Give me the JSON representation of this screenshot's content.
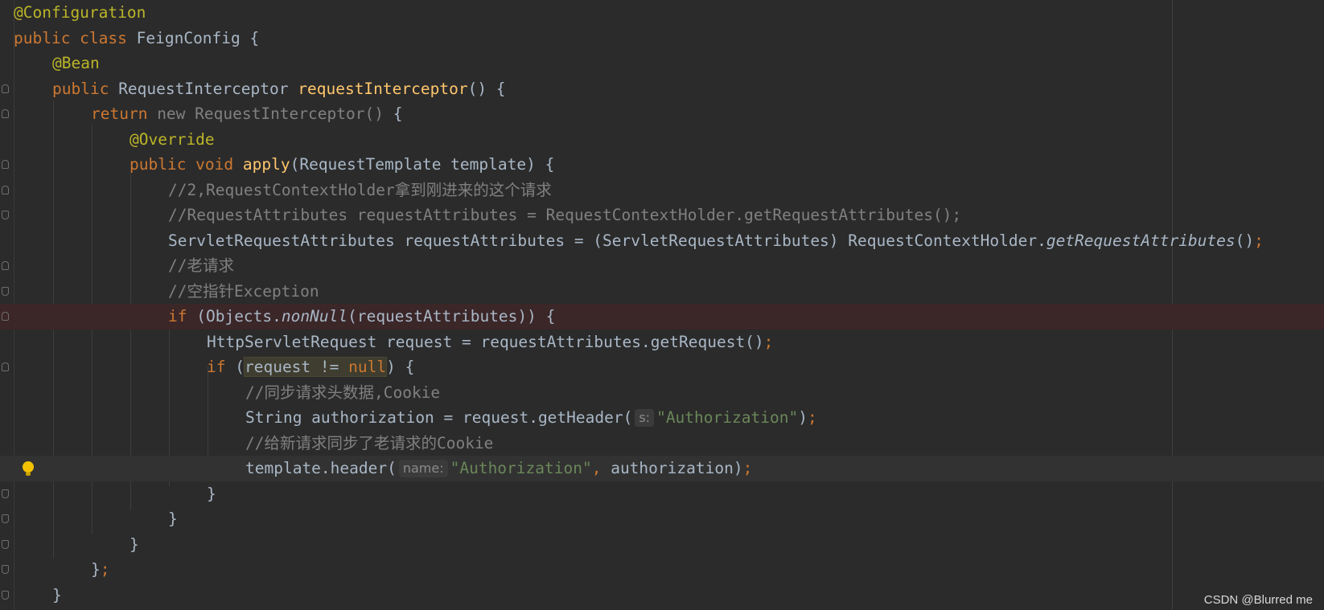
{
  "editor": {
    "language": "Java",
    "colors": {
      "background": "#2b2b2b",
      "keyword": "#cc7832",
      "annotation": "#bbb529",
      "method": "#ffc66d",
      "comment": "#808080",
      "string": "#6a8759",
      "text": "#a9b7c6",
      "error_line": "#3b2628"
    },
    "code": {
      "l1_ann": "@Configuration",
      "l2_kw": "public class ",
      "l2_name": "FeignConfig {",
      "l3_ann": "@Bean",
      "l4_kw": "public ",
      "l4_type": "RequestInterceptor ",
      "l4_fn": "requestInterceptor",
      "l4_rest": "() {",
      "l5_kw": "return ",
      "l5_gray": "new RequestInterceptor() ",
      "l5_rest": "{",
      "l6_ann": "@Override",
      "l7_kw": "public void ",
      "l7_fn": "apply",
      "l7_rest": "(RequestTemplate template) {",
      "l8_cmt": "//2,RequestContextHolder拿到刚进来的这个请求",
      "l9_cmt": "//RequestAttributes requestAttributes = RequestContextHolder.getRequestAttributes();",
      "l10_a": "ServletRequestAttributes requestAttributes = (ServletRequestAttributes) RequestContextHolder.",
      "l10_it": "getRequestAttributes",
      "l10_b": "()",
      "l10_semi": ";",
      "l11_cmt": "//老请求",
      "l12_cmt": "//空指针Exception",
      "l13_kw": "if ",
      "l13_a": "(Objects.",
      "l13_it": "nonNull",
      "l13_b": "(requestAttributes)) {",
      "l14_a": "HttpServletRequest request = requestAttributes.getRequest()",
      "l14_semi": ";",
      "l15_kw": "if ",
      "l15_a": "(",
      "l15_hl_a": "request != ",
      "l15_hl_kw": "null",
      "l15_b": ") {",
      "l16_cmt": "//同步请求头数据,Cookie",
      "l17_a": "String authorization = request.getHeader(",
      "l17_hint": "s:",
      "l17_str": "\"Authorization\"",
      "l17_b": ")",
      "l17_semi": ";",
      "l18_cmt": "//给新请求同步了老请求的Cookie",
      "l19_a": "template.header(",
      "l19_hint": "name:",
      "l19_str": "\"Authorization\"",
      "l19_comma": ", ",
      "l19_b": "authorization)",
      "l19_semi": ";",
      "l20": "}",
      "l21": "}",
      "l22": "}",
      "l23_a": "}",
      "l23_semi": ";",
      "l24": "}"
    }
  },
  "icons": {
    "intention_bulb": "lightbulb-icon",
    "fold_marker": "fold-icon"
  },
  "watermark": "CSDN @Blurred me"
}
